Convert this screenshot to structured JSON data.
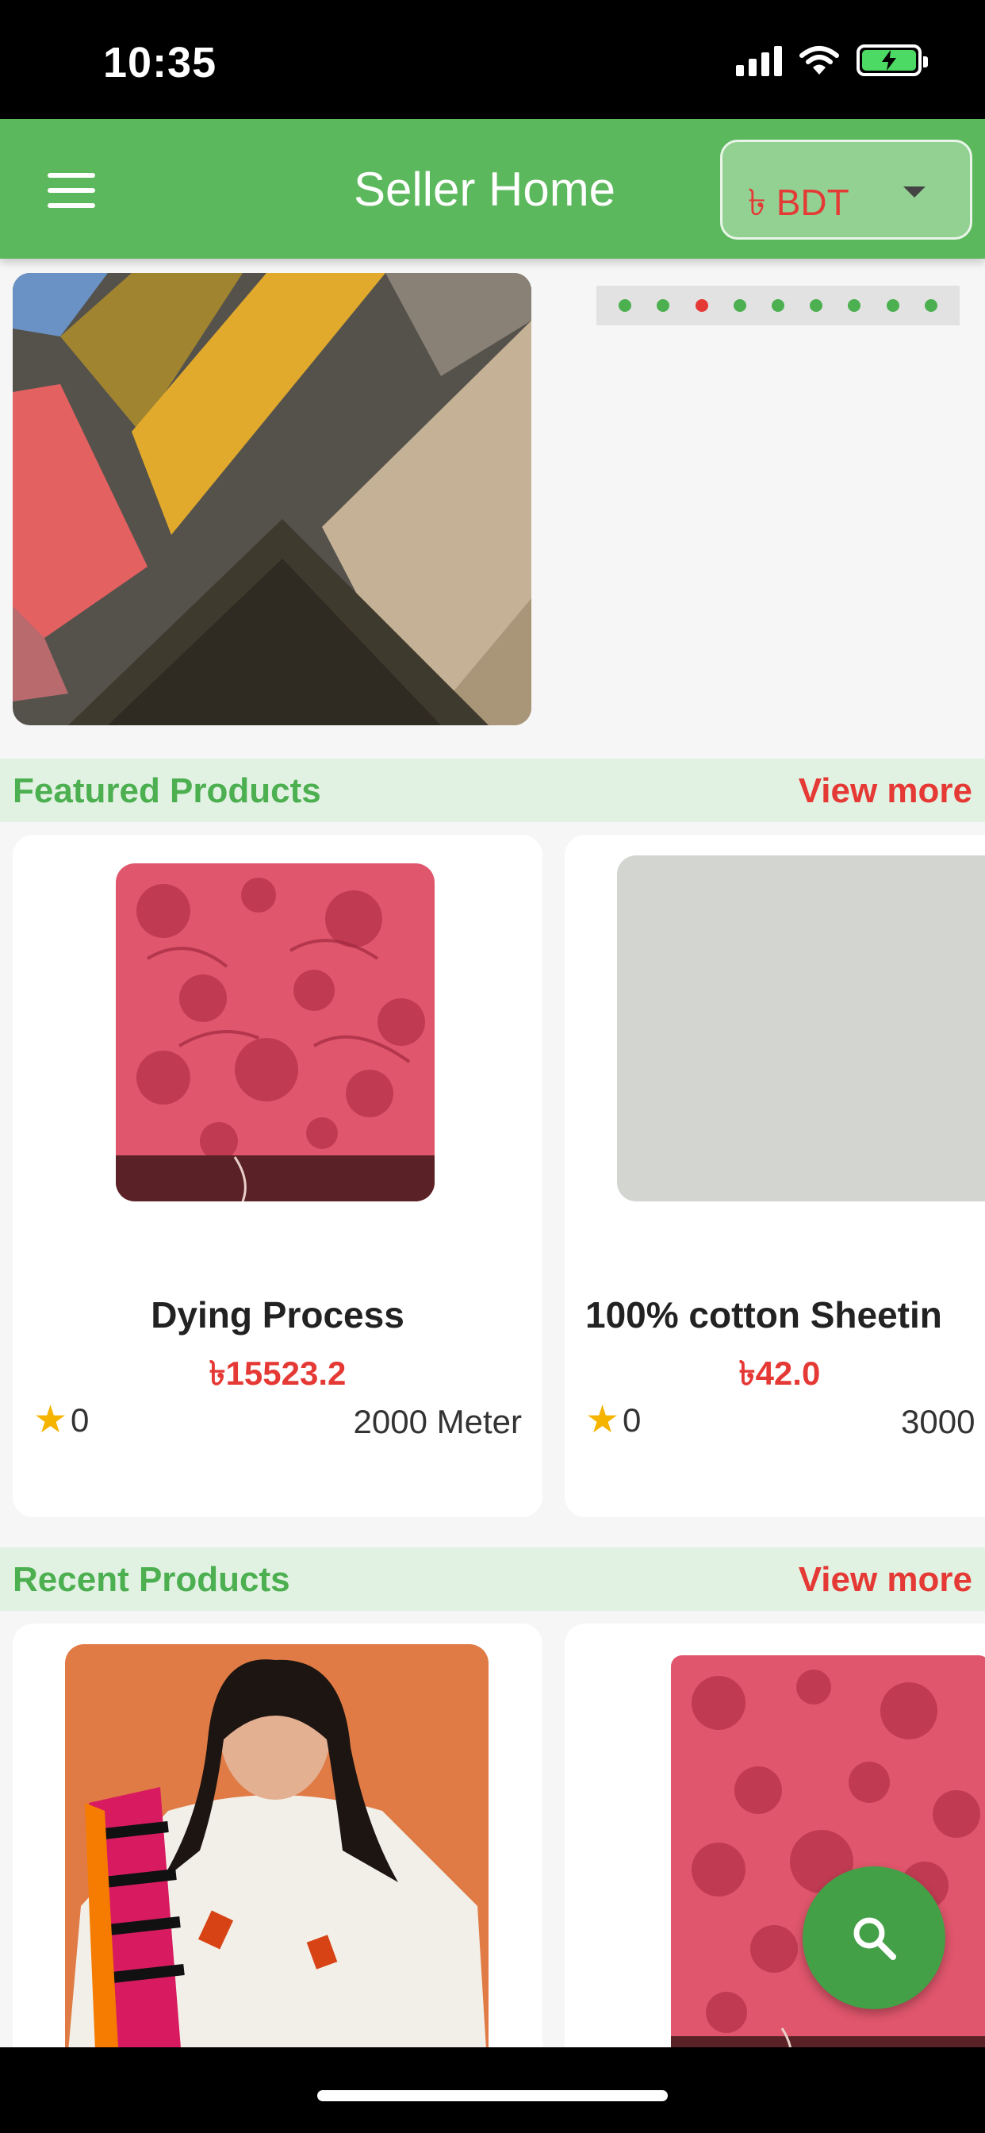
{
  "status_bar": {
    "time": "10:35"
  },
  "app_bar": {
    "title": "Seller Home",
    "currency": "৳ BDT"
  },
  "carousel": {
    "dot_count": 9,
    "active_index": 2
  },
  "featured": {
    "title": "Featured Products",
    "view_more": "View more",
    "products": [
      {
        "name": "Dying Process",
        "price": "৳15523.2",
        "rating": "0",
        "stock": "2000 Meter"
      },
      {
        "name": "100% cotton Sheetin",
        "price": "৳42.0",
        "rating": "0",
        "stock": "3000"
      }
    ]
  },
  "recent": {
    "title": "Recent Products",
    "view_more": "View more"
  },
  "colors": {
    "primary": "#5cb85c",
    "accent_red": "#e53935",
    "section_bg": "#e2f2e2",
    "fab": "#43a047"
  },
  "icons": [
    "menu-icon",
    "dropdown-caret-icon",
    "star-icon",
    "search-icon",
    "signal-icon",
    "wifi-icon",
    "battery-charging-icon"
  ]
}
